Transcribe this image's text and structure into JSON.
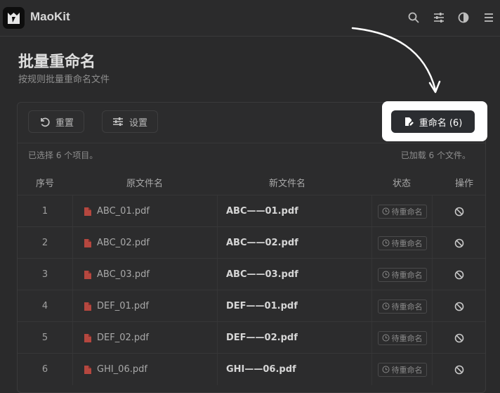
{
  "app": {
    "name": "MaoKit"
  },
  "header": {
    "icons": [
      "search-icon",
      "sliders-icon",
      "theme-toggle-icon",
      "menu-icon"
    ]
  },
  "page": {
    "title": "批量重命名",
    "subtitle": "按规则批量重命名文件"
  },
  "toolbar": {
    "reset_label": "重置",
    "settings_label": "设置",
    "rename_label": "重命名 (6)"
  },
  "status": {
    "selected": "已选择 6 个项目。",
    "loaded": "已加载 6 个文件。"
  },
  "table": {
    "columns": [
      "序号",
      "原文件名",
      "新文件名",
      "状态",
      "操作"
    ],
    "rows": [
      {
        "index": "1",
        "original": "ABC_01.pdf",
        "new": "ABC——01.pdf",
        "status": "待重命名"
      },
      {
        "index": "2",
        "original": "ABC_02.pdf",
        "new": "ABC——02.pdf",
        "status": "待重命名"
      },
      {
        "index": "3",
        "original": "ABC_03.pdf",
        "new": "ABC——03.pdf",
        "status": "待重命名"
      },
      {
        "index": "4",
        "original": "DEF_01.pdf",
        "new": "DEF——01.pdf",
        "status": "待重命名"
      },
      {
        "index": "5",
        "original": "DEF_02.pdf",
        "new": "DEF——02.pdf",
        "status": "待重命名"
      },
      {
        "index": "6",
        "original": "GHI_06.pdf",
        "new": "GHI——06.pdf",
        "status": "待重命名"
      }
    ]
  },
  "colors": {
    "background": "#2a2a2b",
    "highlight": "#ffffff",
    "pdf_icon": "#b5473f"
  }
}
